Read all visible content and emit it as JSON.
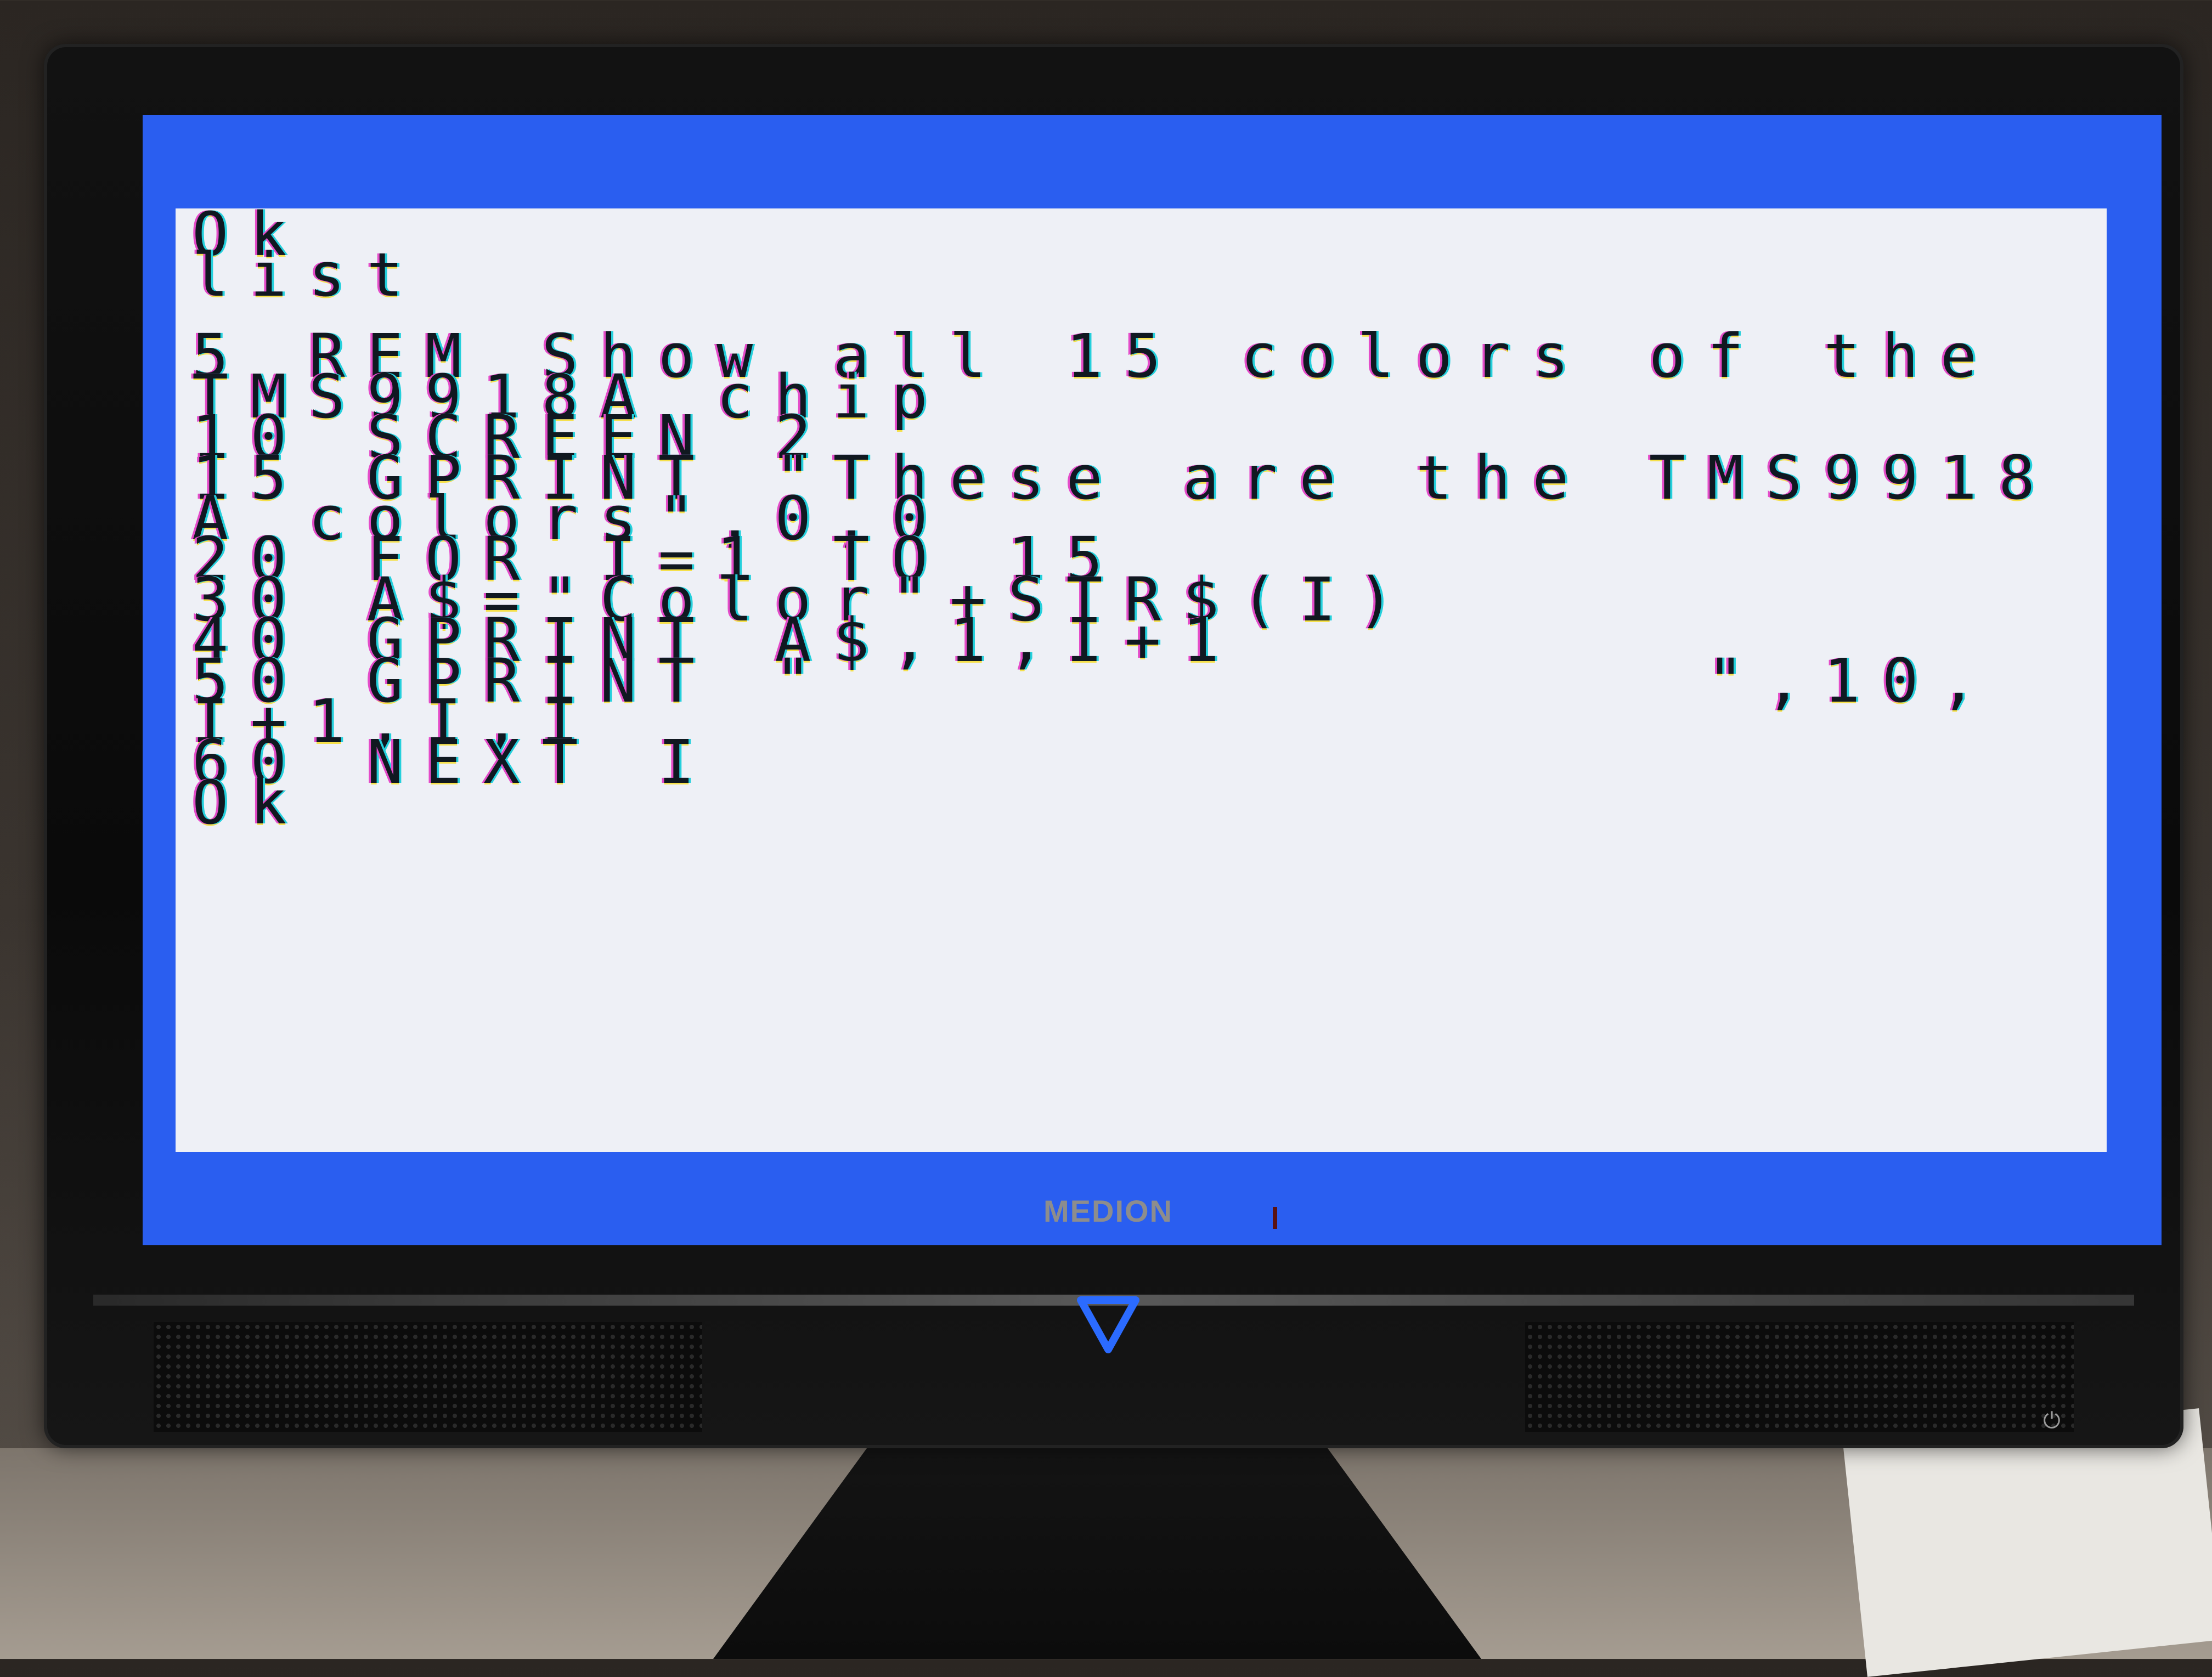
{
  "screen": {
    "lines": [
      "Ok",
      "list",
      "",
      "5 REM Show all 15 colors of the",
      "TMS9918A chip",
      "10 SCREEN 2",
      "15 GPRINT \"These are the TMS9918",
      "A colors\",0,0",
      "20 FOR I=1 TO 15",
      "30 A$=\"Color\"+STR$(I)",
      "40 GPRINT A$,1,I+1",
      "50 GPRINT \"               \",10,",
      "I+1,I,I",
      "60 NEXT I",
      "Ok"
    ],
    "border_color": "#2a5ef0",
    "background_color": "#eef0f6",
    "text_color": "#101820"
  },
  "monitor": {
    "brand": "MEDION",
    "menu_icon": "triangle-down-icon",
    "power_icon": "power-icon",
    "power_symbol": "⏻"
  }
}
